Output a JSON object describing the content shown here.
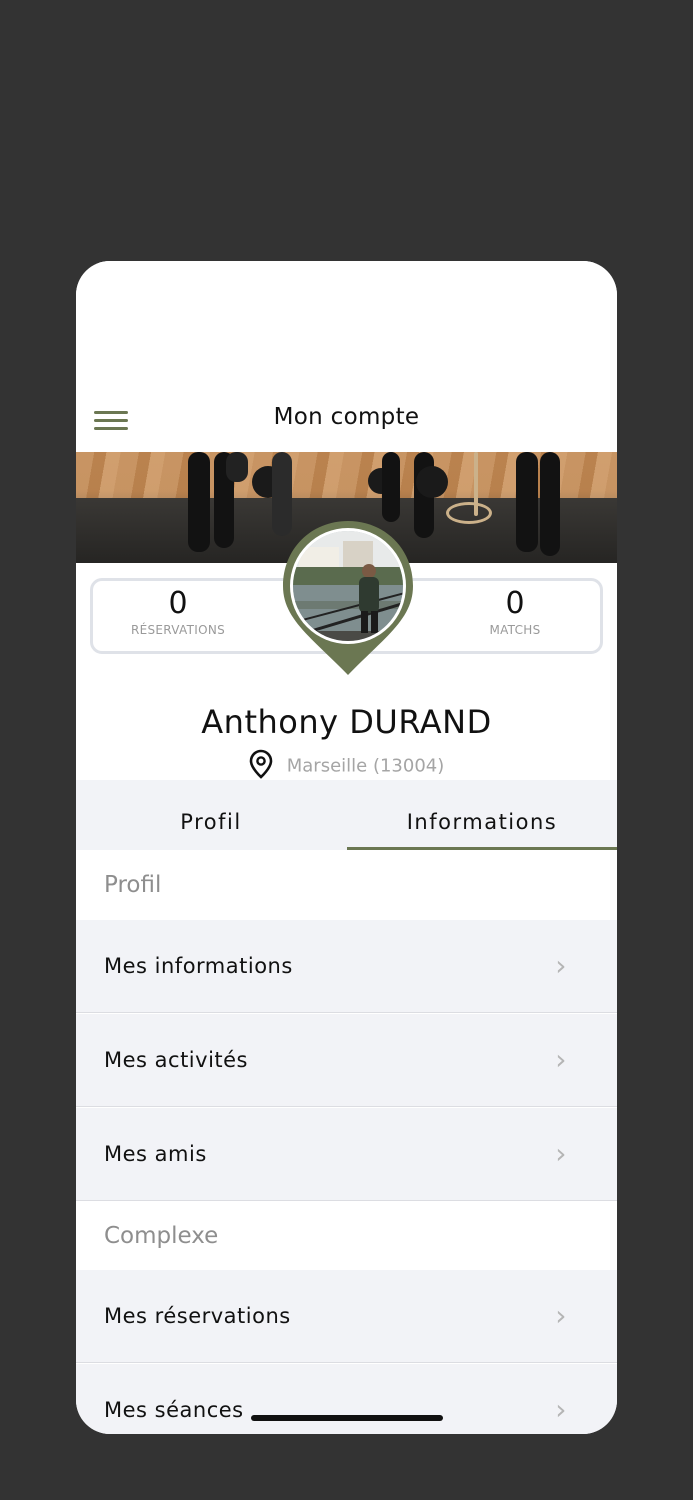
{
  "header": {
    "title": "Mon compte",
    "menu_icon": "hamburger-menu-icon"
  },
  "stats": {
    "left": {
      "value": "0",
      "label": "RÉSERVATIONS"
    },
    "right": {
      "value": "0",
      "label": "MATCHS"
    }
  },
  "profile": {
    "name": "Anthony  DURAND",
    "location": "Marseille (13004)"
  },
  "tabs": [
    {
      "label": "Profil",
      "active": false
    },
    {
      "label": "Informations",
      "active": true
    }
  ],
  "sections": [
    {
      "title": "Profil",
      "items": [
        "Mes informations",
        "Mes activités",
        "Mes amis"
      ]
    },
    {
      "title": "Complexe",
      "items": [
        "Mes réservations",
        "Mes séances"
      ]
    }
  ],
  "colors": {
    "accent": "#6b7752",
    "row_bg": "#f2f3f7",
    "backdrop": "#333333"
  }
}
